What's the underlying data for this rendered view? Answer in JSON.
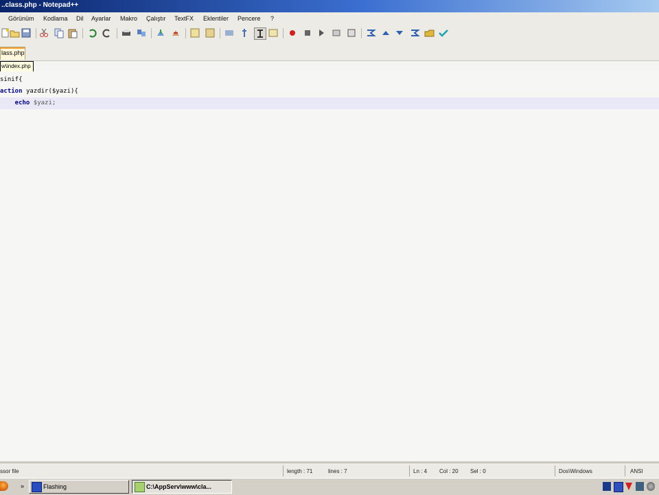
{
  "window": {
    "title": "..class.php - Notepad++"
  },
  "menu": [
    "Görünüm",
    "Kodlama",
    "Dil",
    "Ayarlar",
    "Makro",
    "Çalıştır",
    "TextFX",
    "Eklentiler",
    "Pencere",
    "?"
  ],
  "toolbar": {
    "icons": [
      "new-file-icon",
      "open-file-icon",
      "save-icon",
      "save-all-icon",
      "cut-icon",
      "copy-icon",
      "paste-icon",
      "undo-icon",
      "redo-icon",
      "print-icon",
      "find-icon",
      "zoom-in-icon",
      "zoom-out-icon",
      "wrap-icon",
      "indent-guide-icon",
      "show-all-chars-icon",
      "record-macro-icon",
      "stop-macro-icon",
      "play-macro-icon",
      "run-macro-multiple-icon",
      "save-macro-icon",
      "collapse-icon",
      "up-icon",
      "down-icon",
      "expand-icon",
      "folder-icon",
      "checkmark-icon"
    ]
  },
  "tabs": [
    {
      "label": "lass.php"
    }
  ],
  "tooltip": {
    "text": "w\\index.php"
  },
  "editor": {
    "lines": [
      {
        "parts": [
          {
            "t": "sinif{",
            "c": "fn"
          }
        ]
      },
      {
        "parts": [
          {
            "t": "action ",
            "c": "kw"
          },
          {
            "t": "yazdir($yazi){",
            "c": "fn"
          }
        ]
      },
      {
        "parts": [
          {
            "t": "    echo ",
            "c": "kw"
          },
          {
            "t": "$yazi;",
            "c": "var"
          }
        ],
        "current": true
      }
    ]
  },
  "statusbar": {
    "file_type": "ssor file",
    "length": "length : 71",
    "lines": "lines : 7",
    "ln": "Ln : 4",
    "col": "Col : 20",
    "sel": "Sel : 0",
    "eol": "Dos\\Windows",
    "encoding": "ANSI"
  },
  "taskbar": {
    "quick_launch": "»",
    "buttons": [
      {
        "label": "Flashing"
      },
      {
        "label": "C:\\AppServ\\www\\cla..."
      }
    ]
  },
  "colors": {
    "title_start": "#0a246a",
    "title_end": "#a6caf0",
    "keyword": "#00007f",
    "current_line": "#e8e8f6",
    "tab_accent": "#f0a030"
  }
}
